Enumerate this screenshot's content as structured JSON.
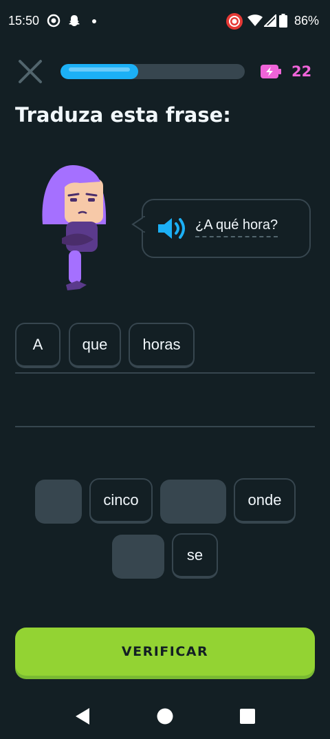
{
  "status_bar": {
    "time": "15:50",
    "battery_percent": "86%",
    "icons": [
      "settings-circle-icon",
      "snapchat-icon",
      "notification-dot-icon",
      "screen-record-icon",
      "wifi-icon",
      "signal-icon",
      "battery-icon"
    ]
  },
  "header": {
    "close_icon": "close-icon",
    "progress_fraction": 0.42,
    "energy_icon": "energy-battery-icon",
    "energy_count": "22"
  },
  "exercise": {
    "title": "Traduza esta frase:",
    "prompt_text": "¿A qué hora?",
    "speaker_icon": "speaker-icon"
  },
  "answer_words": [
    "A",
    "que",
    "horas"
  ],
  "word_bank": {
    "row1": [
      {
        "label": "",
        "used": true
      },
      {
        "label": "cinco",
        "used": false
      },
      {
        "label": "",
        "used": true
      },
      {
        "label": "onde",
        "used": false
      }
    ],
    "row2": [
      {
        "label": "",
        "used": true
      },
      {
        "label": "se",
        "used": false
      }
    ]
  },
  "verify_button": {
    "label": "VERIFICAR"
  },
  "nav_bar": {
    "icons": [
      "back-icon",
      "home-icon",
      "recents-icon"
    ]
  },
  "colors": {
    "background": "#131f24",
    "progress": "#1cb0f6",
    "energy": "#ef64d8",
    "verify": "#93d333",
    "tile_border": "#37464f"
  }
}
